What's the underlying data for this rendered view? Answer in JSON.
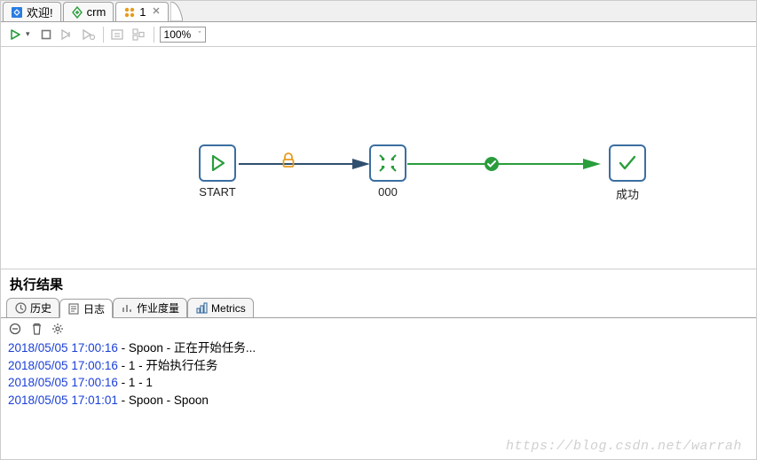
{
  "tabs": {
    "welcome": "欢迎!",
    "crm": "crm",
    "one": "1"
  },
  "toolbar": {
    "zoom": "100%"
  },
  "nodes": {
    "start": {
      "label": "START"
    },
    "mid": {
      "label": "000"
    },
    "end": {
      "label": "成功"
    }
  },
  "results": {
    "title": "执行结果",
    "tabs": {
      "history": "历史",
      "log": "日志",
      "jobmetrics": "作业度量",
      "metrics": "Metrics"
    },
    "log": [
      {
        "ts": "2018/05/05 17:00:16",
        "msg": " - Spoon - 正在开始任务..."
      },
      {
        "ts": "2018/05/05 17:00:16",
        "msg": " - 1 - 开始执行任务"
      },
      {
        "ts": "2018/05/05 17:00:16",
        "msg": " - 1 - 1"
      },
      {
        "ts": "2018/05/05 17:01:01",
        "msg": " - Spoon - Spoon"
      }
    ]
  },
  "watermark": "https://blog.csdn.net/warrah"
}
